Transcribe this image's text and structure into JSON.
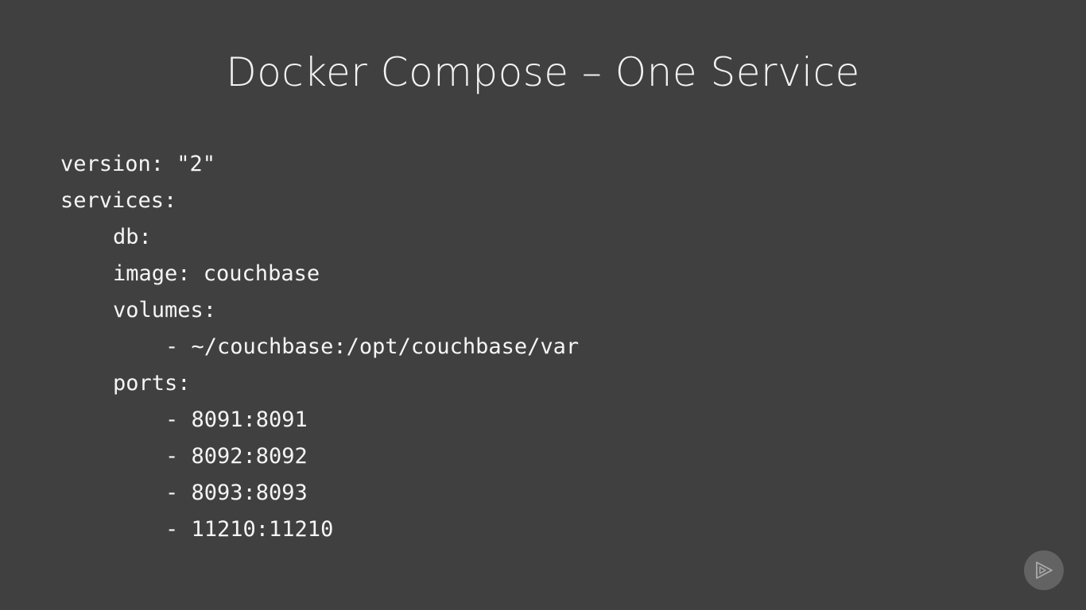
{
  "slide": {
    "title": "Docker Compose – One Service"
  },
  "code": {
    "lines": [
      {
        "text": "version: \"2\"",
        "indent": 0
      },
      {
        "text": "services:",
        "indent": 0
      },
      {
        "text": "db:",
        "indent": 1
      },
      {
        "text": "image: couchbase",
        "indent": 1
      },
      {
        "text": "volumes:",
        "indent": 1
      },
      {
        "text": "- ~/couchbase:/opt/couchbase/var",
        "indent": 2
      },
      {
        "text": "ports:",
        "indent": 1
      },
      {
        "text": "- 8091:8091",
        "indent": 2
      },
      {
        "text": "- 8092:8092",
        "indent": 2
      },
      {
        "text": "- 8093:8093",
        "indent": 2
      },
      {
        "text": "- 11210:11210",
        "indent": 2
      }
    ]
  },
  "logo": {
    "icon": "play-logo-icon"
  },
  "colors": {
    "background": "#404040",
    "text": "#ffffff",
    "logo_bg": "#6a6a6a"
  }
}
